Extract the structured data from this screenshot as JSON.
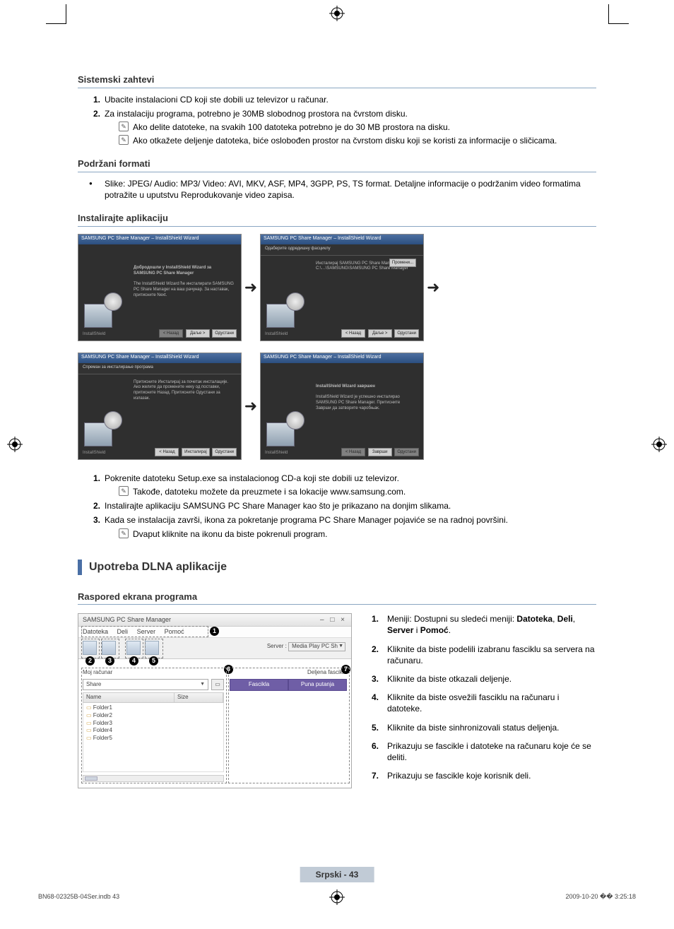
{
  "section1": {
    "title": "Sistemski zahtevi",
    "items": [
      {
        "num": "1",
        "text": "Ubacite instalacioni CD koji ste dobili uz televizor u računar."
      },
      {
        "num": "2",
        "text": "Za instalaciju programa, potrebno je 30MB slobodnog prostora na čvrstom disku."
      }
    ],
    "notes": [
      "Ako delite datoteke, na svakih 100 datoteka potrebno je do 30 MB prostora na disku.",
      "Ako otkažete deljenje datoteka, biće oslobođen prostor na čvrstom disku koji se koristi za informacije o sličicama."
    ]
  },
  "section2": {
    "title": "Podržani formati",
    "bullet": "Slike: JPEG/ Audio: MP3/ Video: AVI, MKV, ASF, MP4, 3GPP, PS, TS format. Detaljne informacije o podržanim video formatima potražite u uputstvu Reprodukovanje video zapisa."
  },
  "section3": {
    "title": "Instalirajte aplikaciju",
    "installer_common": {
      "titlebar": "SAMSUNG PC Share Manager – InstallShield Wizard",
      "back": "< Назад",
      "next": "Даље >",
      "cancel": "Одустани",
      "finish": "Заврши",
      "leftlabel": "InstallShield"
    },
    "installer": [
      {
        "header": "",
        "body_heading": "Добродошли у InstallShield Wizard за SAMSUNG PC Share Manager",
        "body": "The InstallShield Wizard ће инсталирати SAMSUNG PC Share Manager на ваш рачунар. За наставак, притисните Next."
      },
      {
        "header": "Одабeрите одредишну фасциклу",
        "body_heading": "",
        "body": "Инсталирај SAMSUNG PC Share Manager ver.\nC:\\…\\SAMSUNG\\SAMSUNG PC Share Manager"
      },
      {
        "header": "Спреман за инсталирање програма",
        "body_heading": "",
        "body": "Притисните Инсталирај за почетак инсталације.\nАко желите да промените неку од поставки, притисните Назад. Притисните Одустани за излазак."
      },
      {
        "header": "",
        "body_heading": "InstallShield Wizard завршен",
        "body": "InstallShield Wizard је успешно инсталирао SAMSUNG PC Share Manager. Притисните Заврши да затворите чаробњак."
      }
    ],
    "instructions": [
      {
        "num": "1",
        "text": "Pokrenite datoteku Setup.exe sa instalacionog CD-a koji ste dobili uz televizor.",
        "note": "Takođe, datoteku možete da preuzmete i sa lokacije www.samsung.com."
      },
      {
        "num": "2",
        "text": "Instalirajte aplikaciju SAMSUNG PC Share Manager kao što je prikazano na donjim slikama."
      },
      {
        "num": "3",
        "text": "Kada se instalacija završi, ikona za pokretanje programa PC Share Manager pojaviće se na radnoj površini.",
        "note": "Dvaput kliknite na ikonu da biste pokrenuli program."
      }
    ]
  },
  "upotreba": {
    "title": "Upotreba DLNA aplikacije"
  },
  "raspored": {
    "title": "Raspored ekrana programa",
    "app": {
      "window_title": "SAMSUNG PC Share Manager",
      "menus": [
        "Datoteka",
        "Deli",
        "Server",
        "Pomoć"
      ],
      "server_label": "Server :",
      "server_value": "Media Play PC Sh",
      "left_pane_label": "Moj računar",
      "right_pane_label": "Deljena fascikla",
      "combo_value": "Share",
      "columns": [
        "Name",
        "Size"
      ],
      "shared_columns": [
        "Fascikla",
        "Puna putanja"
      ],
      "folders": [
        "Folder1",
        "Folder2",
        "Folder3",
        "Folder4",
        "Folder5"
      ]
    },
    "list": [
      {
        "num": "1",
        "text_pre": "Meniji: Dostupni su sledeći meniji: ",
        "bold": "Datoteka",
        "mid": ", ",
        "bold2": "Deli",
        "mid2": ", ",
        "bold3": "Server",
        "mid3": " i ",
        "bold4": "Pomoć",
        "text_post": "."
      },
      {
        "num": "2",
        "text": "Kliknite da biste podelili izabranu fasciklu sa servera na računaru."
      },
      {
        "num": "3",
        "text": "Kliknite da biste otkazali deljenje."
      },
      {
        "num": "4",
        "text": "Kliknite da biste osvežili fasciklu na računaru i datoteke."
      },
      {
        "num": "5",
        "text": "Kliknite da biste sinhronizovali status deljenja."
      },
      {
        "num": "6",
        "text": "Prikazuju se fascikle i datoteke na računaru koje će se deliti."
      },
      {
        "num": "7",
        "text": "Prikazuju se fascikle koje korisnik deli."
      }
    ]
  },
  "footer": {
    "band": "Srpski - 43",
    "left": "BN68-02325B-04Ser.indb   43",
    "right": "2009-10-20   �� 3:25:18"
  }
}
